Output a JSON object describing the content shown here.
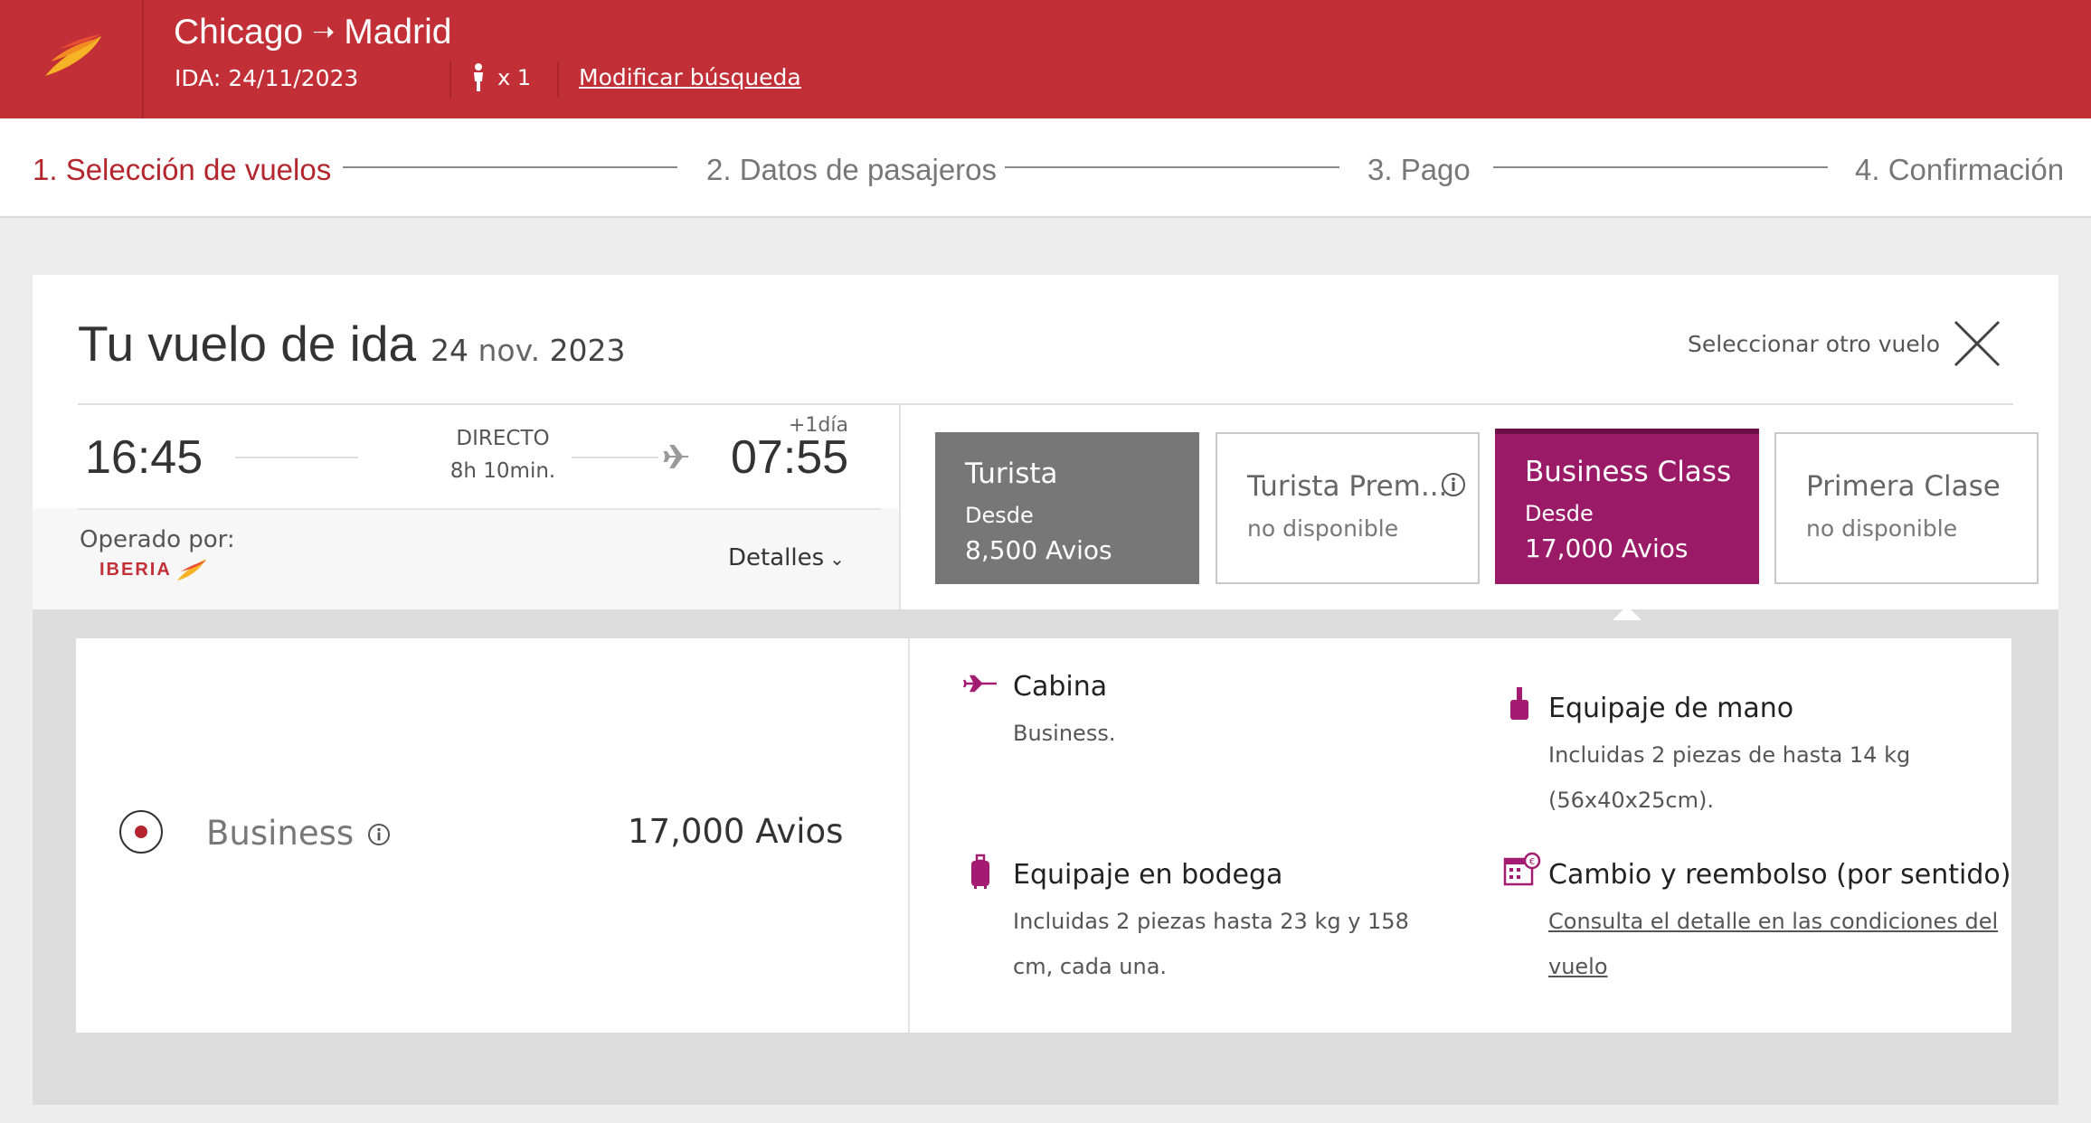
{
  "header": {
    "origin": "Chicago",
    "arrow": "➝",
    "destination": "Madrid",
    "ida_label": "IDA: 24/11/2023",
    "passengers": "x 1",
    "modify_link": "Modificar búsqueda"
  },
  "steps": [
    {
      "label": "1. Selección de vuelos",
      "active": true
    },
    {
      "label": "2. Datos de pasajeros",
      "active": false
    },
    {
      "label": "3. Pago",
      "active": false
    },
    {
      "label": "4. Confirmación",
      "active": false
    }
  ],
  "flight": {
    "title": "Tu vuelo de ida",
    "date_day": "24",
    "date_month": "nov.",
    "date_year": "2023",
    "select_other": "Seleccionar otro vuelo",
    "departure": "16:45",
    "arrival": "07:55",
    "type": "DIRECTO",
    "duration": "8h 10min.",
    "next_day": "+1día",
    "operated_by": "Operado por:",
    "operator_logo_text": "IBERIA",
    "details": "Detalles"
  },
  "fares": [
    {
      "name": "Turista",
      "sub": "Desde",
      "price": "8,500 Avios",
      "color": "#777777"
    },
    {
      "name": "Turista Prem...",
      "sub": "no disponible"
    },
    {
      "name": "Business Class",
      "sub": "Desde",
      "price": "17,000 Avios",
      "color": "#9b1a68"
    },
    {
      "name": "Primera Clase",
      "sub": "no disponible"
    }
  ],
  "selected_fare": {
    "name": "Business",
    "price": "17,000 Avios",
    "features": {
      "cabin_title": "Cabina",
      "cabin_text": "Business.",
      "hand_title": "Equipaje de mano",
      "hand_text": "Incluidas 2 piezas de hasta 14 kg (56x40x25cm).",
      "hold_title": "Equipaje en bodega",
      "hold_text": "Incluidas 2 piezas hasta 23 kg y 158 cm, cada una.",
      "change_title": "Cambio y reembolso (por sentido)",
      "change_link": "Consulta el detalle en las condiciones del vuelo"
    }
  },
  "colors": {
    "brand_red": "#c32f36",
    "business_purple": "#9b1a68",
    "icon_purple": "#a31c72"
  }
}
